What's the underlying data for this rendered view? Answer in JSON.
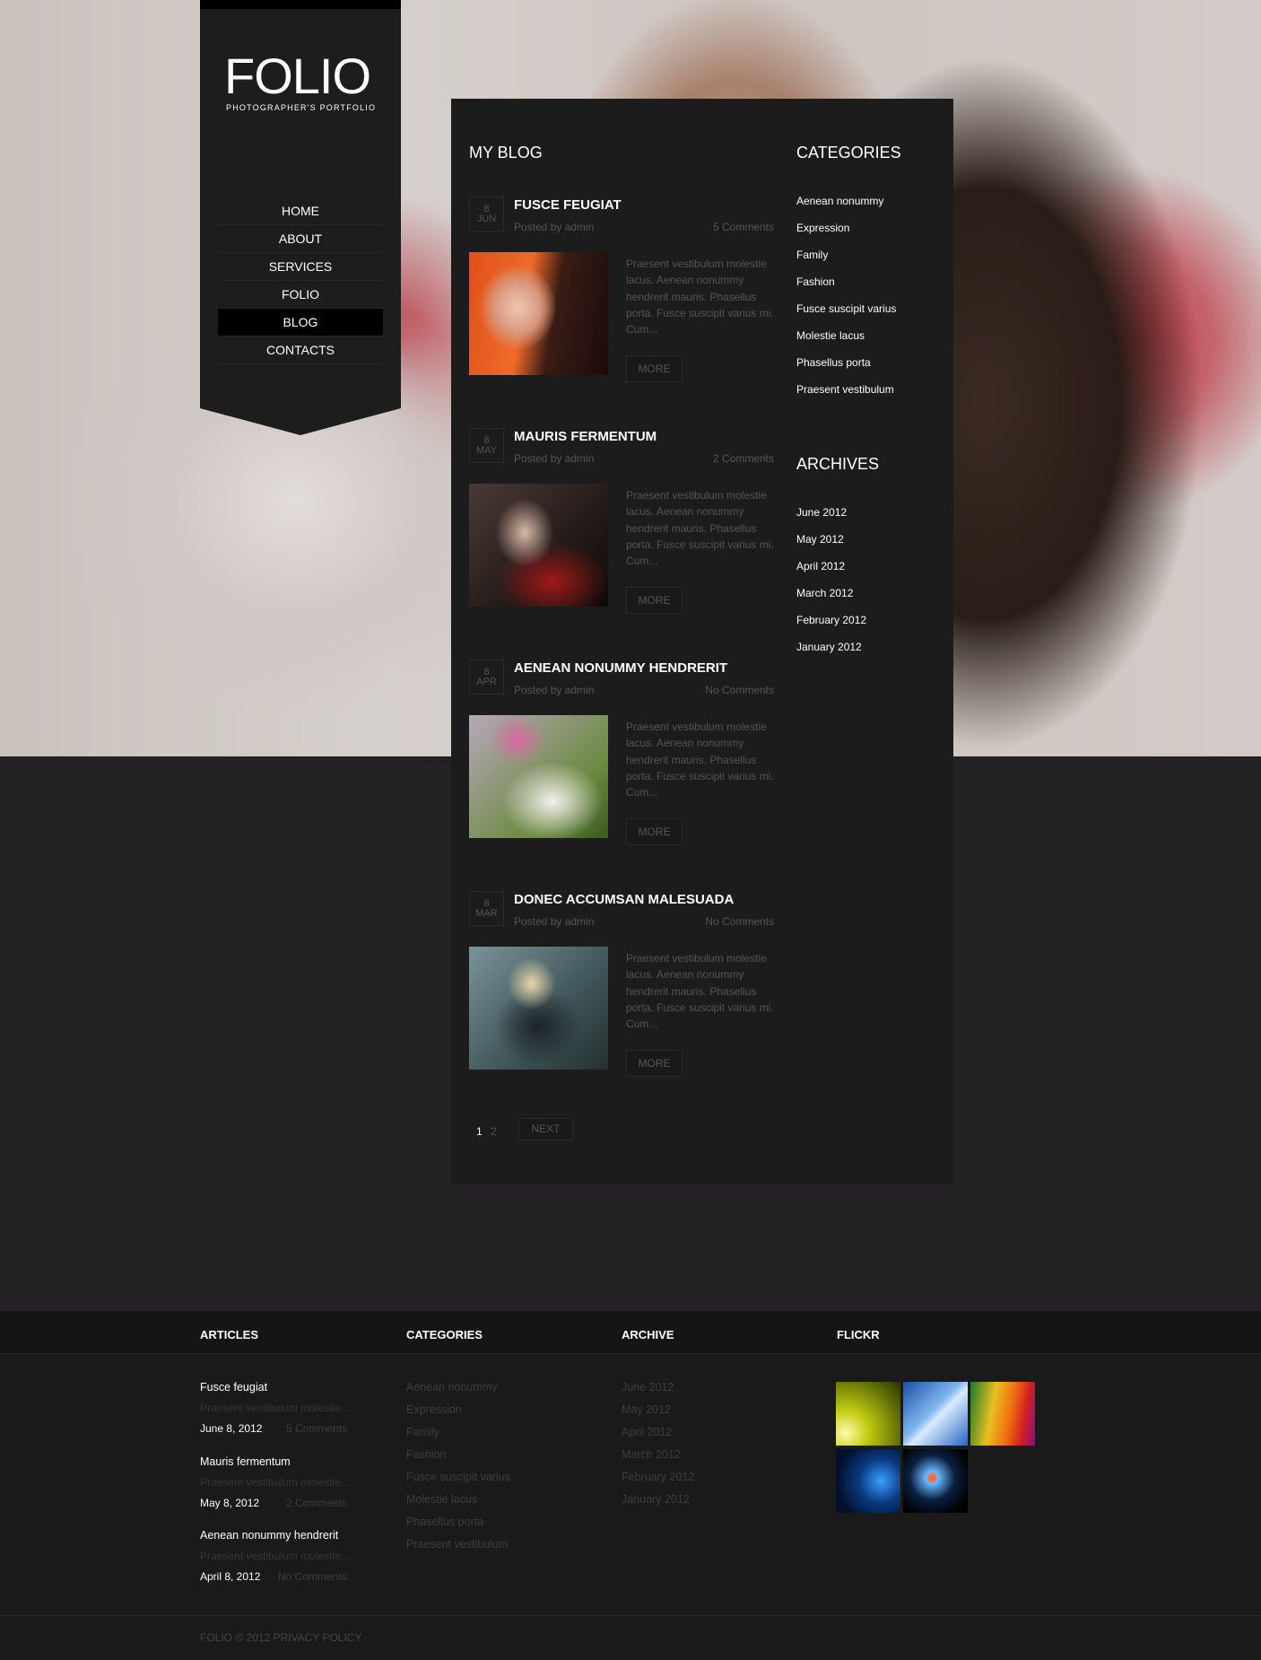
{
  "brand": {
    "logo": "FOLIO",
    "tagline": "PHOTOGRAPHER'S PORTFOLIO"
  },
  "nav": [
    {
      "label": "HOME"
    },
    {
      "label": "ABOUT"
    },
    {
      "label": "SERVICES"
    },
    {
      "label": "FOLIO"
    },
    {
      "label": "BLOG",
      "active": true
    },
    {
      "label": "CONTACTS"
    }
  ],
  "blog": {
    "title": "MY BLOG",
    "posts": [
      {
        "day": "8",
        "month": "JUN",
        "title": "FUSCE FEUGIAT",
        "posted": "Posted by admin",
        "comments": "5 Comments",
        "excerpt": "Praesent vestibulum molestie lacus. Aenean nonummy hendrerit mauris. Phasellus porta. Fusce suscipit varius mi. Cum...",
        "more": "MORE"
      },
      {
        "day": "8",
        "month": "MAY",
        "title": "MAURIS FERMENTUM",
        "posted": "Posted by admin",
        "comments": "2 Comments",
        "excerpt": "Praesent vestibulum molestie lacus. Aenean nonummy hendrerit mauris. Phasellus porta. Fusce suscipit varius mi. Cum...",
        "more": "MORE"
      },
      {
        "day": "8",
        "month": "APR",
        "title": "AENEAN NONUMMY HENDRERIT",
        "posted": "Posted by admin",
        "comments": "No Comments",
        "excerpt": "Praesent vestibulum molestie lacus. Aenean nonummy hendrerit mauris. Phasellus porta. Fusce suscipit varius mi. Cum...",
        "more": "MORE"
      },
      {
        "day": "8",
        "month": "MAR",
        "title": "DONEC ACCUMSAN MALESUADA",
        "posted": "Posted by admin",
        "comments": "No Comments",
        "excerpt": "Praesent vestibulum molestie lacus. Aenean nonummy hendrerit mauris. Phasellus porta. Fusce suscipit varius mi. Cum...",
        "more": "MORE"
      }
    ],
    "pagination": {
      "pages": [
        "1",
        "2"
      ],
      "current": "1",
      "next": "NEXT"
    }
  },
  "categories": {
    "title": "CATEGORIES",
    "items": [
      "Aenean nonummy",
      "Expression",
      "Family",
      "Fashion",
      "Fusce suscipit varius",
      "Molestie lacus",
      "Phasellus porta",
      "Praesent vestibulum"
    ]
  },
  "archives": {
    "title": "ARCHIVES",
    "items": [
      "June 2012",
      "May 2012",
      "April 2012",
      "March 2012",
      "February 2012",
      "January 2012"
    ]
  },
  "footer": {
    "articles": {
      "title": "ARTICLES",
      "items": [
        {
          "title": "Fusce feugiat",
          "excerpt": "Praesent vestibulum molestie...",
          "date": "June 8, 2012",
          "comments": "5 Comments"
        },
        {
          "title": "Mauris fermentum",
          "excerpt": "Praesent vestibulum molestie...",
          "date": "May 8, 2012",
          "comments": "2 Comments"
        },
        {
          "title": "Aenean nonummy hendrerit",
          "excerpt": "Praesent vestibulum molestie...",
          "date": "April 8, 2012",
          "comments": "No Comments"
        }
      ]
    },
    "categories": {
      "title": "CATEGORIES"
    },
    "archive": {
      "title": "ARCHIVE"
    },
    "flickr": {
      "title": "FLICKR"
    },
    "copyright": "FOLIO © 2012 PRIVACY POLICY"
  }
}
